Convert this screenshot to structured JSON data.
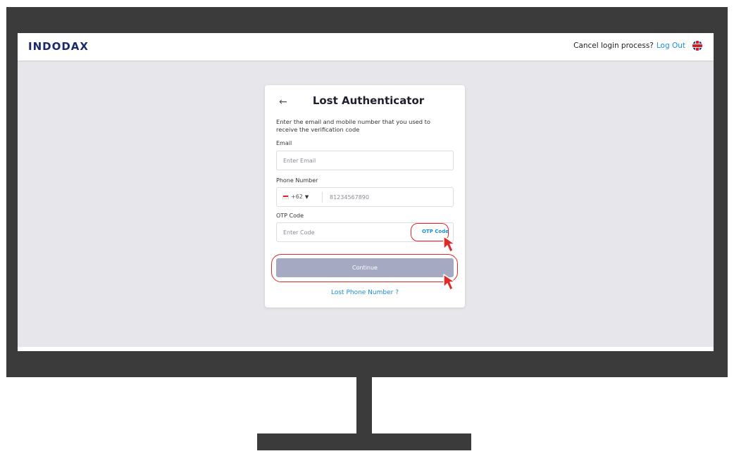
{
  "navbar": {
    "logo": "INDODAX",
    "cancel_text": "Cancel login process?",
    "logout_label": "Log Out",
    "language_icon": "uk-flag-icon"
  },
  "card": {
    "back_icon": "back-arrow-icon",
    "title": "Lost Authenticator",
    "description": "Enter the email and mobile number that you used to receive the verification code",
    "email": {
      "label": "Email",
      "placeholder": "Enter Email",
      "value": ""
    },
    "phone": {
      "label": "Phone Number",
      "country_code": "+62",
      "placeholder": "81234567890",
      "value": ""
    },
    "otp": {
      "label": "OTP Code",
      "placeholder": "Enter Code",
      "value": "",
      "link_label": "OTP Code"
    },
    "continue_label": "Continue",
    "lost_phone_label": "Lost Phone Number ?"
  },
  "colors": {
    "frame": "#3b3b3b",
    "screen_bg": "#e7e7eb",
    "link": "#1a8fd8",
    "button_disabled": "#a6a9c2",
    "highlight": "#e02929"
  }
}
